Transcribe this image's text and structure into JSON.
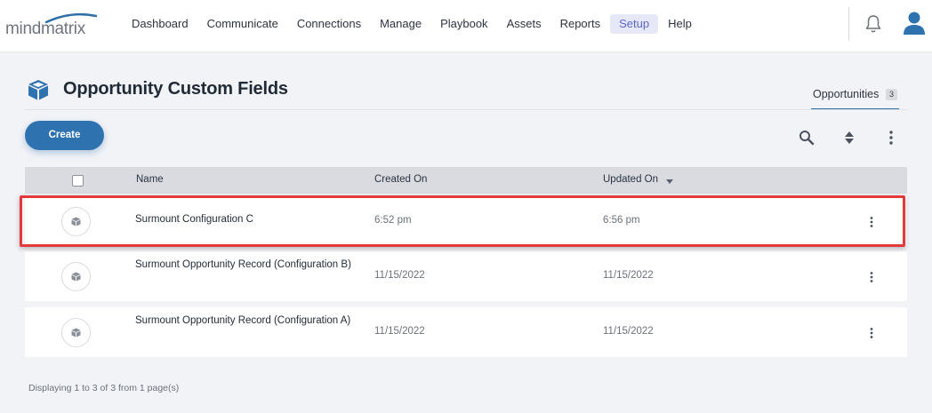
{
  "app": {
    "logo_text": "mindmatrix"
  },
  "nav": {
    "items": [
      "Dashboard",
      "Communicate",
      "Connections",
      "Manage",
      "Playbook",
      "Assets",
      "Reports",
      "Setup",
      "Help"
    ],
    "active": "Setup"
  },
  "page": {
    "title": "Opportunity Custom Fields"
  },
  "tabs": [
    {
      "label": "Opportunities",
      "count": "3"
    }
  ],
  "toolbar": {
    "create_label": "Create"
  },
  "table": {
    "columns": [
      "Name",
      "Created On",
      "Updated On"
    ],
    "sorted_column": "Updated On",
    "rows": [
      {
        "name": "Surmount Configuration C",
        "created": "6:52 pm",
        "updated": "6:56 pm"
      },
      {
        "name": "Surmount Opportunity Record (Configuration B)",
        "created": "11/15/2022",
        "updated": "11/15/2022"
      },
      {
        "name": "Surmount Opportunity Record (Configuration A)",
        "created": "11/15/2022",
        "updated": "11/15/2022"
      }
    ]
  },
  "footer": {
    "text": "Displaying 1 to 3 of 3 from 1 page(s)"
  },
  "colors": {
    "accent": "#2f72b0",
    "highlight": "#e4383d",
    "active_nav": "#5d66c9"
  }
}
